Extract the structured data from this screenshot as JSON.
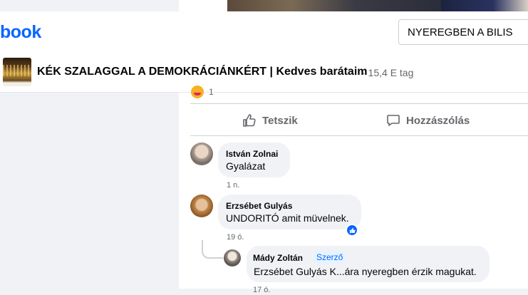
{
  "header": {
    "logo_text": "book",
    "search_value": "NYEREGBEN A BILIS",
    "accent_color": "#0866ff"
  },
  "post": {
    "title": "KÉK SZALAGGAL A DEMOKRÁCIÁNKÉRT | Kedves barátaim",
    "meta": "· 15,4 E tag",
    "reaction_count": "1"
  },
  "actions": {
    "like_label": "Tetszik",
    "comment_label": "Hozzászólás"
  },
  "comments": [
    {
      "author": "István Zolnai",
      "text": "Gyalázat",
      "time": "1 n."
    },
    {
      "author": "Erzsébet Gulyás",
      "text": "UNDORITÓ amit müvelnek.",
      "time": "19 ó."
    }
  ],
  "reply": {
    "author": "Mády Zoltán",
    "badge": "Szerző",
    "text": "Erzsébet Gulyás K...ára nyeregben érzik magukat.",
    "time": "17 ó."
  }
}
